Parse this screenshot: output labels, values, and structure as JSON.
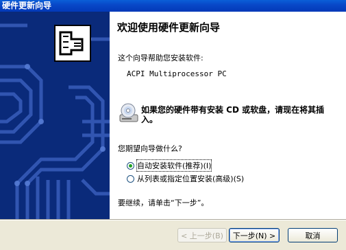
{
  "window": {
    "title": "硬件更新向导"
  },
  "main": {
    "heading": "欢迎使用硬件更新向导",
    "description": "这个向导帮助您安装软件:",
    "device_name": "ACPI Multiprocessor PC",
    "cd_prompt": "如果您的硬件带有安装 CD 或软盘，请现在将其插入。",
    "question": "您期望向导做什么?",
    "options": [
      {
        "label": "自动安装软件(推荐)(I)",
        "checked": true
      },
      {
        "label": "从列表或指定位置安装(高级)(S)",
        "checked": false
      }
    ],
    "continue_text": "要继续，请单击“下一步”。"
  },
  "buttons": {
    "back": "< 上一步(B)",
    "next": "下一步(N) >",
    "cancel": "取消"
  },
  "colors": {
    "sidebar": "#0a2a7a",
    "titlebar": "#0848c8",
    "radio_dot": "#21a121"
  },
  "icons": {
    "sidebar": "hardware-card-icon",
    "cd": "cd-drive-icon"
  }
}
